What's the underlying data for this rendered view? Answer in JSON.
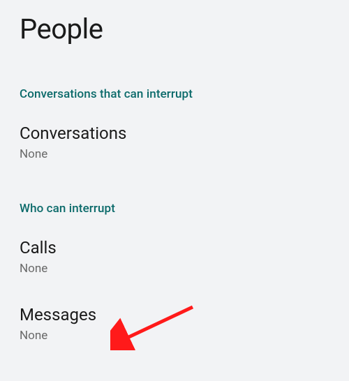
{
  "page_title": "People",
  "sections": [
    {
      "header": "Conversations that can interrupt",
      "items": [
        {
          "title": "Conversations",
          "value": "None"
        }
      ]
    },
    {
      "header": "Who can interrupt",
      "items": [
        {
          "title": "Calls",
          "value": "None"
        },
        {
          "title": "Messages",
          "value": "None"
        }
      ]
    }
  ]
}
